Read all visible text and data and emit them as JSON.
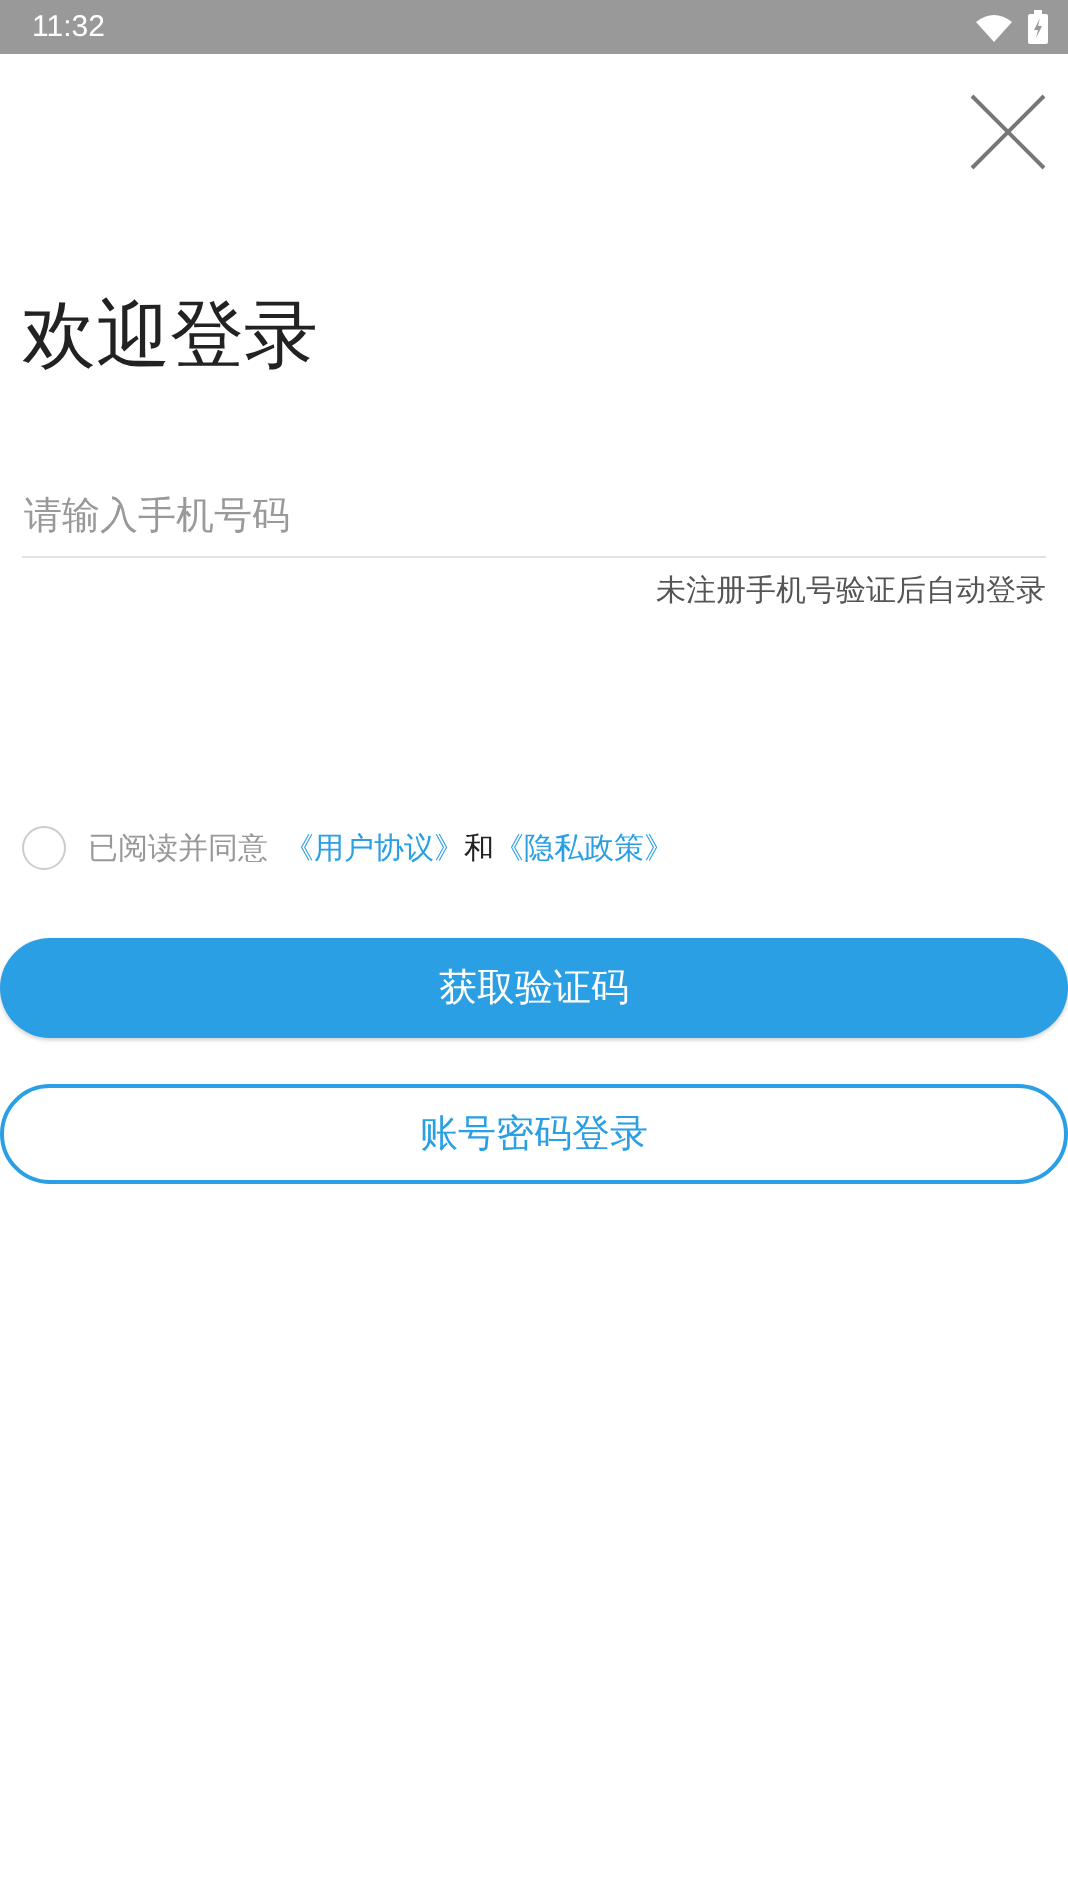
{
  "status_bar": {
    "time": "11:32"
  },
  "title": "欢迎登录",
  "phone_field": {
    "placeholder": "请输入手机号码"
  },
  "hint": "未注册手机号验证后自动登录",
  "agreement": {
    "checked": false,
    "text": "已阅读并同意",
    "links": [
      "《用户协议》",
      "《隐私政策》"
    ],
    "joiner": "和"
  },
  "buttons": [
    {
      "label": "获取验证码",
      "kind": "primary"
    },
    {
      "label": "账号密码登录",
      "kind": "outline"
    }
  ]
}
